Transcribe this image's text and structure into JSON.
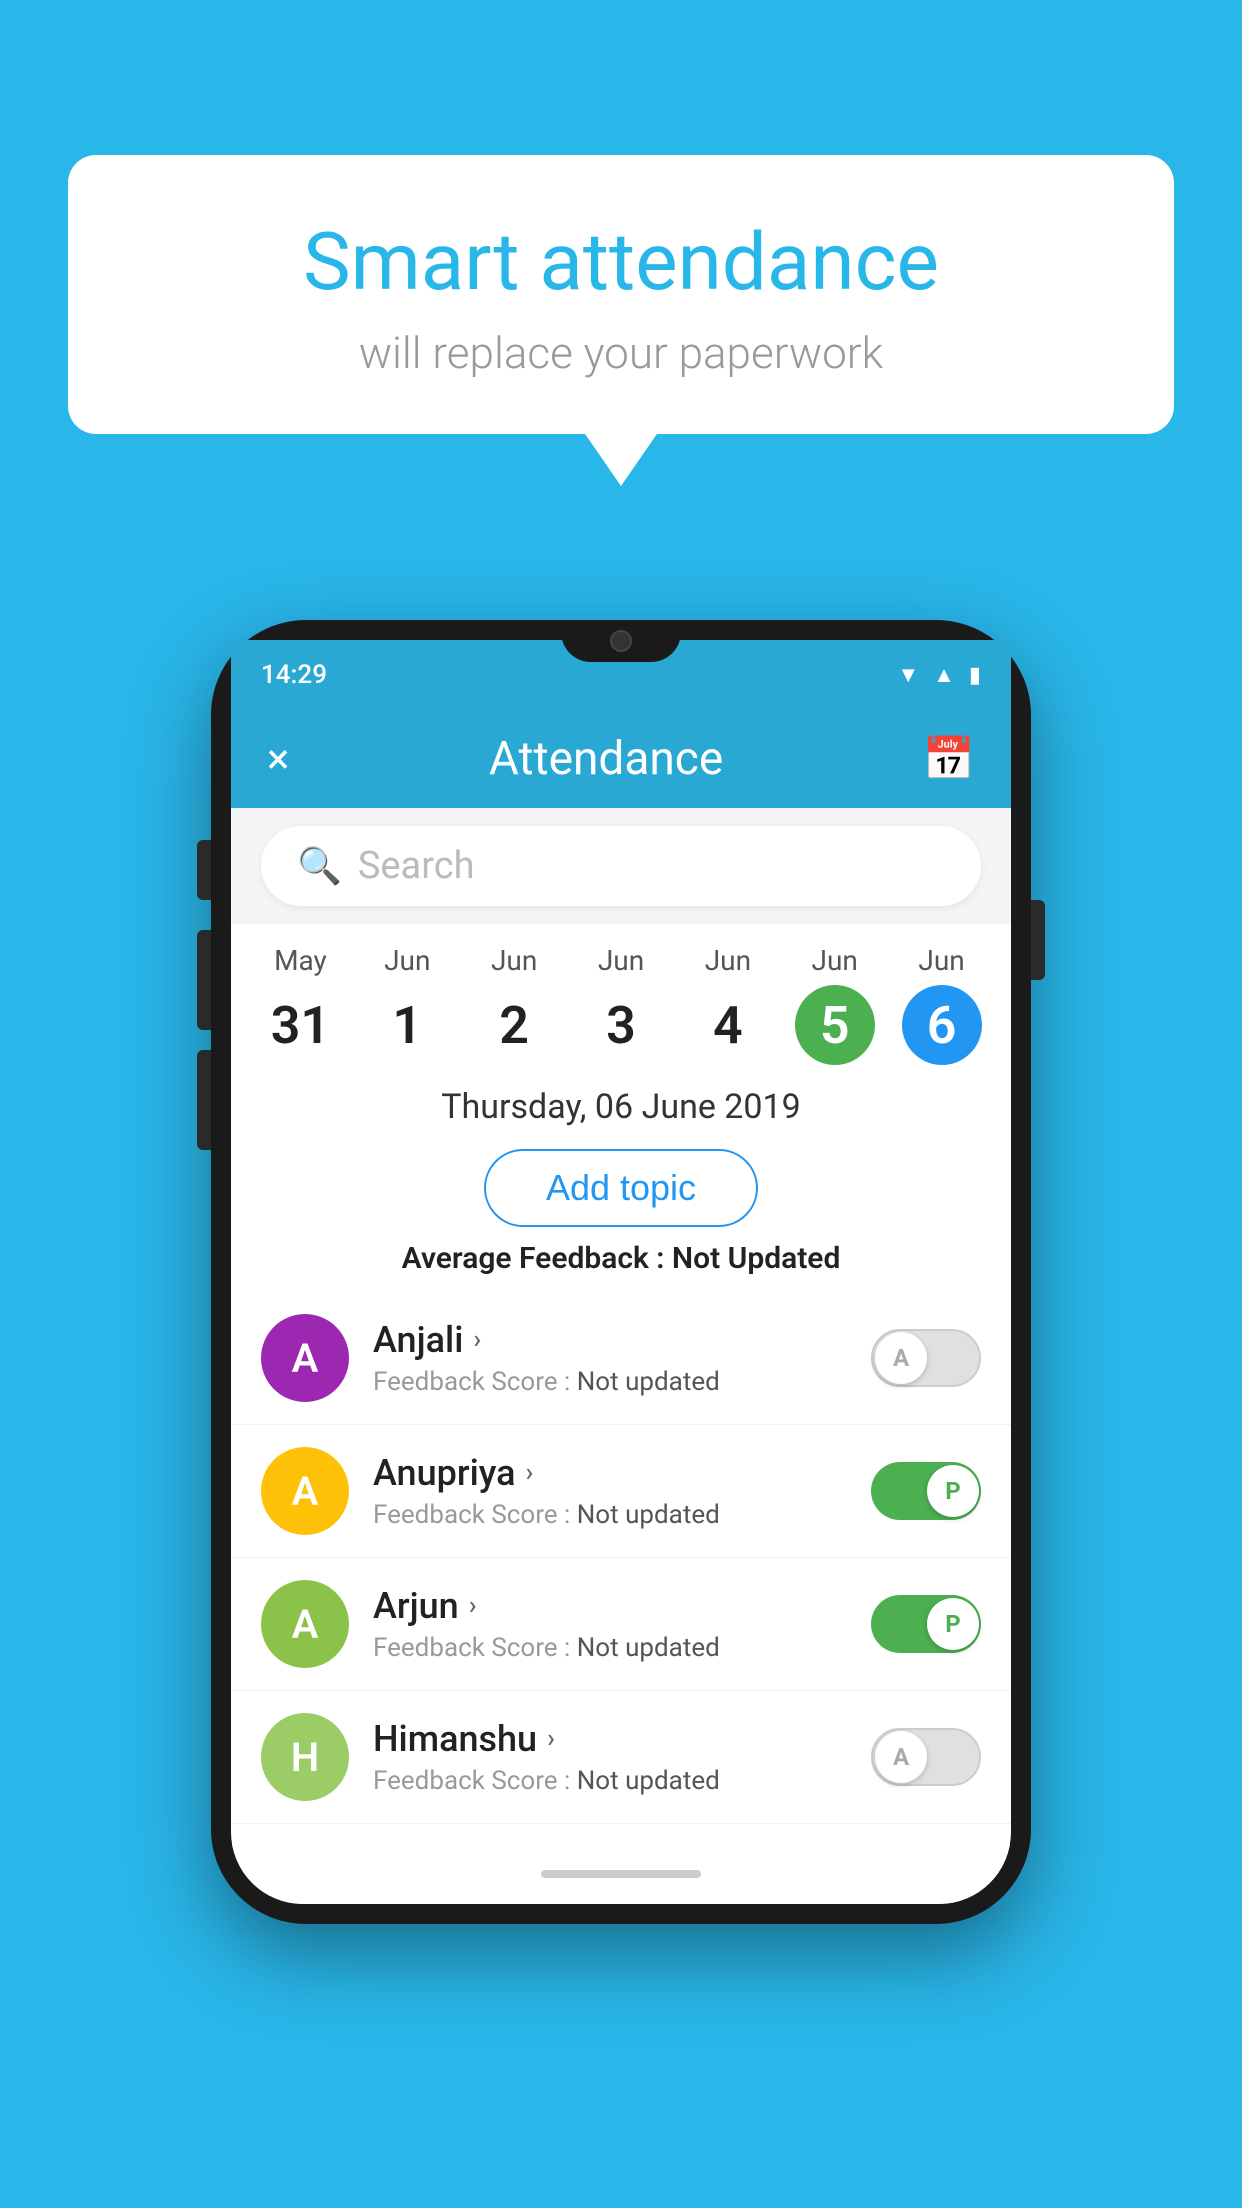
{
  "background_color": "#29b6e8",
  "speech_bubble": {
    "title": "Smart attendance",
    "subtitle": "will replace your paperwork"
  },
  "phone": {
    "status_time": "14:29",
    "app_header": {
      "title": "Attendance",
      "close_label": "×",
      "calendar_icon": "📅"
    },
    "search": {
      "placeholder": "Search"
    },
    "calendar": {
      "days": [
        {
          "month": "May",
          "date": "31",
          "style": "normal"
        },
        {
          "month": "Jun",
          "date": "1",
          "style": "normal"
        },
        {
          "month": "Jun",
          "date": "2",
          "style": "normal"
        },
        {
          "month": "Jun",
          "date": "3",
          "style": "normal"
        },
        {
          "month": "Jun",
          "date": "4",
          "style": "normal"
        },
        {
          "month": "Jun",
          "date": "5",
          "style": "green"
        },
        {
          "month": "Jun",
          "date": "6",
          "style": "blue"
        }
      ]
    },
    "selected_date": "Thursday, 06 June 2019",
    "add_topic_label": "Add topic",
    "avg_feedback_label": "Average Feedback :",
    "avg_feedback_value": "Not Updated",
    "students": [
      {
        "name": "Anjali",
        "avatar_letter": "A",
        "avatar_color": "#9c27b0",
        "feedback_label": "Feedback Score :",
        "feedback_value": "Not updated",
        "toggle_state": "inactive",
        "toggle_letter": "A"
      },
      {
        "name": "Anupriya",
        "avatar_letter": "A",
        "avatar_color": "#ffc107",
        "feedback_label": "Feedback Score :",
        "feedback_value": "Not updated",
        "toggle_state": "active",
        "toggle_letter": "P"
      },
      {
        "name": "Arjun",
        "avatar_letter": "A",
        "avatar_color": "#8bc34a",
        "feedback_label": "Feedback Score :",
        "feedback_value": "Not updated",
        "toggle_state": "active",
        "toggle_letter": "P"
      },
      {
        "name": "Himanshu",
        "avatar_letter": "H",
        "avatar_color": "#9ccc65",
        "feedback_label": "Feedback Score :",
        "feedback_value": "Not updated",
        "toggle_state": "inactive",
        "toggle_letter": "A"
      }
    ]
  }
}
